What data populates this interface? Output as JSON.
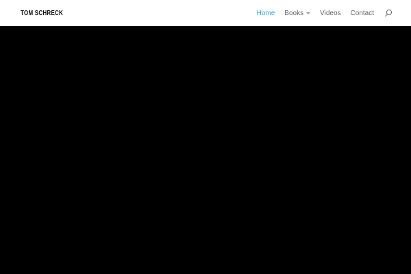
{
  "header": {
    "logo_text": "TOM SCHRECK",
    "nav": {
      "items": [
        {
          "label": "Home",
          "active": true,
          "has_dropdown": false
        },
        {
          "label": "Books",
          "active": false,
          "has_dropdown": true
        },
        {
          "label": "Videos",
          "active": false,
          "has_dropdown": false
        },
        {
          "label": "Contact",
          "active": false,
          "has_dropdown": false
        }
      ],
      "search_icon": "magnifying-glass"
    }
  },
  "hero": {
    "description": "solid black hero section, no visible content"
  },
  "colors": {
    "accent_active_link": "#2ea3f2",
    "nav_link": "#666666",
    "logo_text": "#111111",
    "header_background": "#ffffff",
    "hero_background": "#000000"
  }
}
